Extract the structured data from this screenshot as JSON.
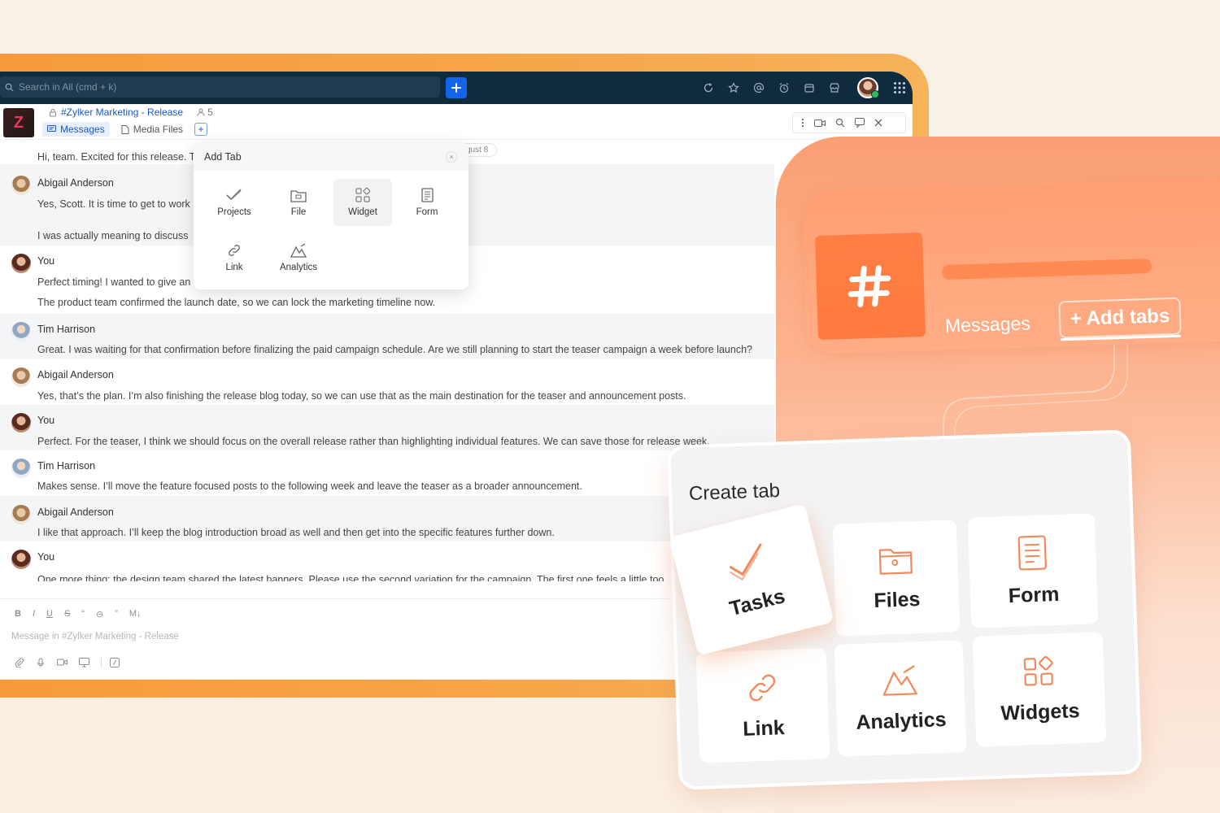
{
  "app": {
    "search_placeholder": "Search in All (cmd + k)",
    "channel_name": "#Zylker Marketing - Release",
    "member_count": "5",
    "tabs": [
      {
        "label": "Messages",
        "active": true
      },
      {
        "label": "Media Files",
        "active": false
      }
    ]
  },
  "messages": {
    "date_pill": "gust 8",
    "items": [
      {
        "user": "",
        "text": "Hi, team. Excited for this release. T"
      },
      {
        "user": "Abigail Anderson",
        "text": "Yes, Scott. It is time to get to work",
        "text2": "I was actually meaning to discuss"
      },
      {
        "user": "You",
        "text": "Perfect timing! I wanted to give an",
        "text2": "The product team confirmed the launch date, so we can lock the marketing timeline now."
      },
      {
        "user": "Tim Harrison",
        "text": "Great. I was waiting for that confirmation before finalizing the paid campaign schedule. Are we still planning to start the teaser campaign a week before launch?"
      },
      {
        "user": "Abigail Anderson",
        "text": "Yes, that’s the plan. I’m also finishing the release blog today, so we can use that as the main destination for the teaser and announcement posts."
      },
      {
        "user": "You",
        "text": "Perfect. For the teaser, I think we should focus on the overall release rather than highlighting individual features. We can save those for release week."
      },
      {
        "user": "Tim Harrison",
        "text": "Makes sense. I’ll move the feature focused posts to the following week and leave the teaser as a broader announcement."
      },
      {
        "user": "Abigail Anderson",
        "text": "I like that approach. I’ll keep the blog introduction broad as well and then get into the specific features further down."
      },
      {
        "user": "You",
        "text": "One more thing: the design team shared the latest banners. Please use the second variation for the campaign. The first one feels a little too"
      }
    ]
  },
  "composer": {
    "placeholder": "Message in #Zylker Marketing - Release",
    "format_buttons": [
      "B",
      "I",
      "U",
      "S",
      "“",
      "⊝",
      "”",
      "M↓"
    ]
  },
  "add_tab_popup": {
    "title": "Add Tab",
    "close": "×",
    "items": [
      "Projects",
      "File",
      "Widget",
      "Form",
      "Link",
      "Analytics"
    ]
  },
  "promo": {
    "messages_label": "Messages",
    "add_tabs_label": "+ Add tabs",
    "create_tab_title": "Create tab",
    "tiles": [
      "Tasks",
      "Files",
      "Form",
      "Link",
      "Analytics",
      "Widgets"
    ],
    "accent": "#ff7a3e"
  }
}
